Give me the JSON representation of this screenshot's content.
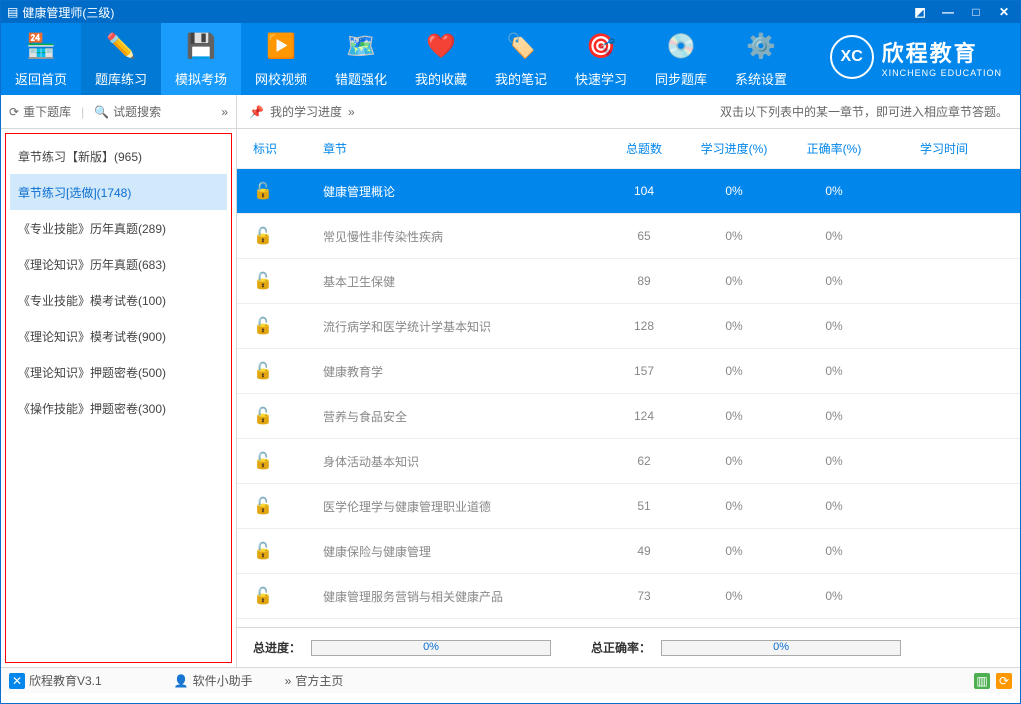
{
  "window": {
    "title": "健康管理师(三级)"
  },
  "toolbar": [
    {
      "label": "返回首页",
      "icon": "home"
    },
    {
      "label": "题库练习",
      "icon": "pencil"
    },
    {
      "label": "模拟考场",
      "icon": "save"
    },
    {
      "label": "网校视频",
      "icon": "play"
    },
    {
      "label": "错题强化",
      "icon": "map"
    },
    {
      "label": "我的收藏",
      "icon": "heart"
    },
    {
      "label": "我的笔记",
      "icon": "tag"
    },
    {
      "label": "快速学习",
      "icon": "target"
    },
    {
      "label": "同步题库",
      "icon": "disk"
    },
    {
      "label": "系统设置",
      "icon": "gear"
    }
  ],
  "brand": {
    "name": "欣程教育",
    "sub": "XINCHENG EDUCATION",
    "logo": "XC"
  },
  "sidebar": {
    "top_reload": "重下题库",
    "top_search": "试题搜索",
    "items": [
      "章节练习【新版】(965)",
      "章节练习[选做](1748)",
      "《专业技能》历年真题(289)",
      "《理论知识》历年真题(683)",
      "《专业技能》模考试卷(100)",
      "《理论知识》模考试卷(900)",
      "《理论知识》押题密卷(500)",
      "《操作技能》押题密卷(300)"
    ],
    "selected": 1
  },
  "main": {
    "progress_label": "我的学习进度",
    "hint": "双击以下列表中的某一章节，即可进入相应章节答题。",
    "columns": {
      "flag": "标识",
      "chapter": "章节",
      "total": "总题数",
      "progress": "学习进度(%)",
      "rate": "正确率(%)",
      "time": "学习时间"
    },
    "rows": [
      {
        "chapter": "健康管理概论",
        "total": "104",
        "progress": "0%",
        "rate": "0%"
      },
      {
        "chapter": "常见慢性非传染性疾病",
        "total": "65",
        "progress": "0%",
        "rate": "0%"
      },
      {
        "chapter": "基本卫生保健",
        "total": "89",
        "progress": "0%",
        "rate": "0%"
      },
      {
        "chapter": "流行病学和医学统计学基本知识",
        "total": "128",
        "progress": "0%",
        "rate": "0%"
      },
      {
        "chapter": "健康教育学",
        "total": "157",
        "progress": "0%",
        "rate": "0%"
      },
      {
        "chapter": "营养与食品安全",
        "total": "124",
        "progress": "0%",
        "rate": "0%"
      },
      {
        "chapter": "身体活动基本知识",
        "total": "62",
        "progress": "0%",
        "rate": "0%"
      },
      {
        "chapter": "医学伦理学与健康管理职业道德",
        "total": "51",
        "progress": "0%",
        "rate": "0%"
      },
      {
        "chapter": "健康保险与健康管理",
        "total": "49",
        "progress": "0%",
        "rate": "0%"
      },
      {
        "chapter": "健康管理服务营销与相关健康产品",
        "total": "73",
        "progress": "0%",
        "rate": "0%"
      }
    ],
    "selected": 0,
    "summary": {
      "total_progress_label": "总进度：",
      "total_progress": "0%",
      "total_rate_label": "总正确率：",
      "total_rate": "0%"
    }
  },
  "status": {
    "app": "欣程教育V3.1",
    "helper": "软件小助手",
    "home": "官方主页"
  }
}
